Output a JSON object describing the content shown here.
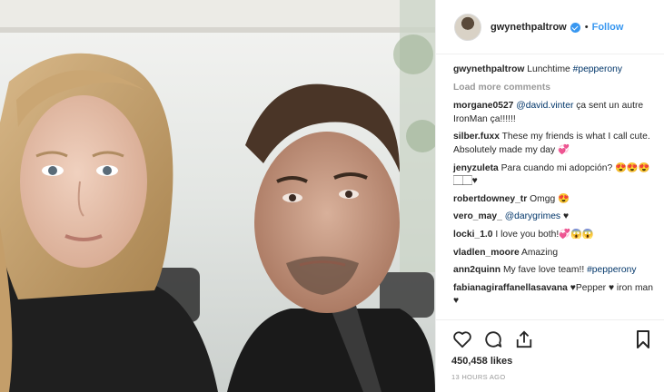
{
  "post": {
    "photo_alt": "Selfie photo",
    "header": {
      "username": "gwynethpaltrow",
      "dot": "•",
      "follow_label": "Follow"
    },
    "caption": {
      "username": "gwynethpaltrow",
      "text": "Lunchtime ",
      "hashtag": "#pepperony"
    },
    "load_more": "Load more comments",
    "comments": [
      {
        "user": "morgane0527",
        "mention": "@david.vinter",
        "text": " ça sent un autre IronMan ça!!!!!!"
      },
      {
        "user": "silber.fuxx",
        "mention": "",
        "text": "These my friends is what I call cute. Absolutely made my day 💞"
      },
      {
        "user": "jenyzuleta",
        "mention": "",
        "text": "Para cuando mi adopción? 😍😍😍🏻🏻♥"
      },
      {
        "user": "robertdowney_tr",
        "mention": "",
        "text": "Omgg 😍"
      },
      {
        "user": "vero_may_",
        "mention": "@darygrimes",
        "text": " ♥"
      },
      {
        "user": "locki_1.0",
        "mention": "",
        "text": "I love you both!💞😱😱"
      },
      {
        "user": "vladlen_moore",
        "mention": "",
        "text": "Amazing"
      },
      {
        "user": "ann2quinn",
        "mention": "",
        "text": "My fave love team!! ",
        "hashtag": "#pepperony"
      },
      {
        "user": "fabianagiraffanellasavana",
        "mention": "",
        "text": "♥Pepper ♥ iron man ♥"
      }
    ],
    "likes": "450,458 likes",
    "time": "13 HOURS AGO",
    "icons": {
      "like": "heart-icon",
      "comment": "comment-icon",
      "share": "share-icon",
      "save": "bookmark-icon"
    }
  }
}
